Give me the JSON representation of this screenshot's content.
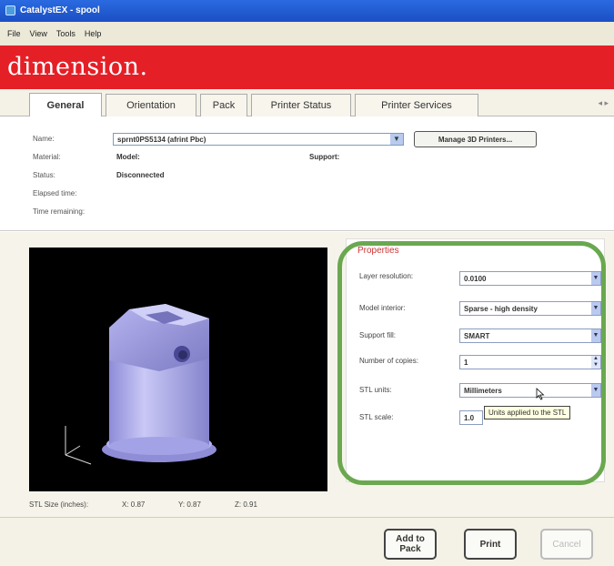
{
  "window": {
    "title": "CatalystEX - spool"
  },
  "menu": [
    "File",
    "View",
    "Tools",
    "Help"
  ],
  "brand": {
    "logo_text": "dimension."
  },
  "tabs": [
    {
      "label": "General",
      "active": true
    },
    {
      "label": "Orientation",
      "active": false
    },
    {
      "label": "Pack",
      "active": false
    },
    {
      "label": "Printer Status",
      "active": false
    },
    {
      "label": "Printer Services",
      "active": false
    }
  ],
  "general": {
    "name_label": "Name:",
    "name_value": "sprnt0PS5134 (afrint Pbc)",
    "manage_button": "Manage 3D Printers...",
    "material_label": "Material:",
    "material_value": "Model:",
    "support_label": "Support:",
    "status_label": "Status:",
    "status_value": "Disconnected",
    "elapsed_label": "Elapsed time:",
    "remaining_label": "Time remaining:"
  },
  "stl_size": {
    "label": "STL Size (inches):",
    "x": "X: 0.87",
    "y": "Y: 0.87",
    "z": "Z: 0.91"
  },
  "properties": {
    "title": "Properties",
    "layer_resolution": {
      "label": "Layer resolution:",
      "value": "0.0100"
    },
    "model_interior": {
      "label": "Model interior:",
      "value": "Sparse - high density"
    },
    "support_fill": {
      "label": "Support fill:",
      "value": "SMART"
    },
    "copies": {
      "label": "Number of copies:",
      "value": "1"
    },
    "stl_units": {
      "label": "STL units:",
      "value": "Millimeters"
    },
    "stl_scale": {
      "label": "STL scale:",
      "value": "1.0"
    },
    "tooltip": "Units applied to the STL"
  },
  "actions": {
    "add_to_pack": "Add to Pack",
    "print": "Print",
    "cancel": "Cancel"
  },
  "colors": {
    "brand_red": "#e51f26",
    "highlight_green": "#6aa84f",
    "model_lavender": "#b9b7f0"
  }
}
